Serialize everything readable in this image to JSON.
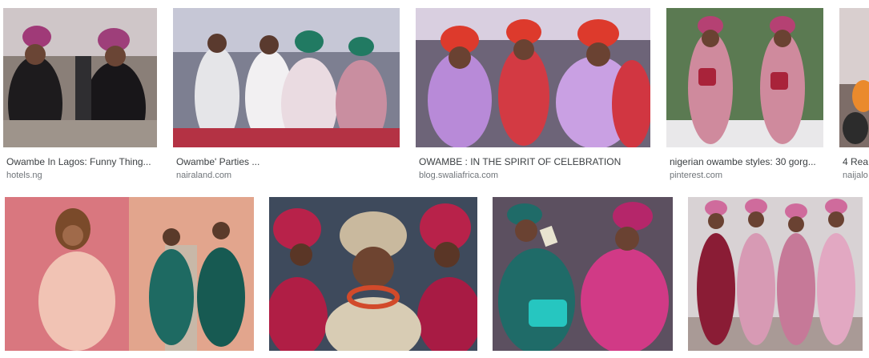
{
  "results": [
    {
      "title": "Owambe In Lagos: Funny Thing...",
      "source": "hotels.ng"
    },
    {
      "title": "Owambe' Parties ...",
      "source": "nairaland.com"
    },
    {
      "title": "OWAMBE : IN THE SPIRIT OF CELEBRATION",
      "source": "blog.swaliafrica.com"
    },
    {
      "title": "nigerian owambe styles: 30 gorg...",
      "source": "pinterest.com"
    },
    {
      "title": "4 Rea",
      "source": "naijalo"
    }
  ],
  "icons": {
    "thumbnail": "photo-thumbnail"
  },
  "colors": {
    "caption": "#3c4043",
    "source": "#70757a"
  }
}
